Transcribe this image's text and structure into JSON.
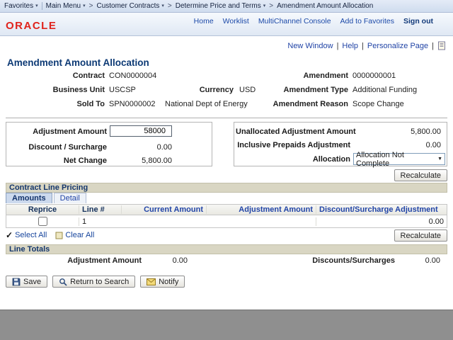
{
  "colors": {
    "brand_red": "#e0231c",
    "link_blue": "#2144a6",
    "title_navy": "#0d3a75",
    "section_header_bg": "#d9d6c3"
  },
  "glyphs": {
    "menu_arrow": "▾",
    "breadcrumb_separator": ">",
    "link_separator": "|",
    "dropdown_arrow": "▼",
    "select_all_check": "✓"
  },
  "breadcrumb": {
    "favorites": "Favorites",
    "items": [
      "Main Menu",
      "Customer Contracts",
      "Determine Price and Terms",
      "Amendment Amount Allocation"
    ]
  },
  "header": {
    "brand": "ORACLE",
    "links": [
      "Home",
      "Worklist",
      "MultiChannel Console",
      "Add to Favorites"
    ],
    "signout": "Sign out"
  },
  "pagebar": {
    "links": [
      "New Window",
      "Help",
      "Personalize Page"
    ]
  },
  "page": {
    "title": "Amendment Amount Allocation"
  },
  "summary": {
    "contract": {
      "label": "Contract",
      "value": "CON0000004"
    },
    "amendment": {
      "label": "Amendment",
      "value": "0000000001"
    },
    "business_unit": {
      "label": "Business Unit",
      "value": "USCSP"
    },
    "currency": {
      "label": "Currency",
      "value": "USD"
    },
    "amendment_type": {
      "label": "Amendment Type",
      "value": "Additional Funding"
    },
    "sold_to": {
      "label": "Sold To",
      "value": "SPN0000002",
      "name": "National Dept of Energy"
    },
    "amendment_reason": {
      "label": "Amendment Reason",
      "value": "Scope Change"
    }
  },
  "adjustments": {
    "adjustment_amount": {
      "label": "Adjustment Amount",
      "value": "58000"
    },
    "discount_surcharge": {
      "label": "Discount / Surcharge",
      "value": "0.00"
    },
    "net_change": {
      "label": "Net Change",
      "value": "5,800.00"
    }
  },
  "allocation": {
    "unallocated": {
      "label": "Unallocated Adjustment Amount",
      "value": "5,800.00"
    },
    "inclusive_prepaids": {
      "label": "Inclusive Prepaids Adjustment",
      "value": "0.00"
    },
    "status": {
      "label": "Allocation",
      "value": "Allocation Not Complete"
    }
  },
  "grid": {
    "title": "Contract Line Pricing",
    "tabs": [
      "Amounts",
      "Detail"
    ],
    "columns": [
      "Reprice",
      "Line #",
      "Current Amount",
      "Adjustment Amount",
      "Discount/Surcharge Adjustment"
    ],
    "rows": [
      {
        "line": "1",
        "current_amount": "",
        "adjustment_amount": "",
        "discount_surcharge_adjustment": "0.00"
      }
    ],
    "select_all": "Select All",
    "clear_all": "Clear All"
  },
  "line_totals": {
    "title": "Line Totals",
    "adjustment_amount": {
      "label": "Adjustment Amount",
      "value": "0.00"
    },
    "discounts_surcharges": {
      "label": "Discounts/Surcharges",
      "value": "0.00"
    }
  },
  "actions": {
    "recalculate": "Recalculate",
    "save": "Save",
    "return_to_search": "Return to Search",
    "notify": "Notify"
  }
}
